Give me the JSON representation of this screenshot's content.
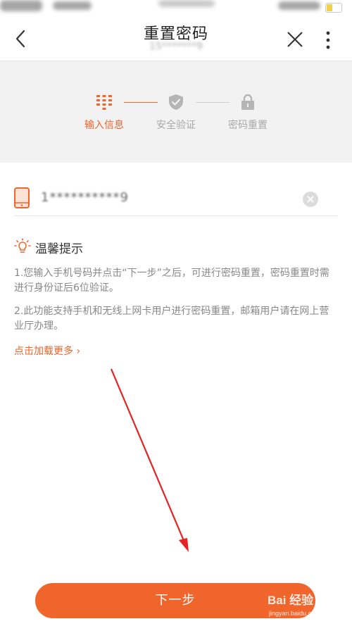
{
  "header": {
    "title": "重置密码",
    "subtitle": "15*******9"
  },
  "steps": [
    {
      "label": "输入信息",
      "state": "active",
      "icon": "keypad-icon"
    },
    {
      "label": "安全验证",
      "state": "inactive",
      "icon": "shield-check-icon"
    },
    {
      "label": "密码重置",
      "state": "inactive",
      "icon": "lock-icon"
    }
  ],
  "phone": {
    "value": "1**********9",
    "icon": "mobile-phone-icon"
  },
  "tips": {
    "title": "温馨提示",
    "items": [
      "1.您输入手机号码并点击“下一步”之后，可进行密码重置，密码重置时需进行身份证后6位验证。",
      "2.此功能支持手机和无线上网卡用户进行密码重置，邮箱用户请在网上营业厅办理。"
    ],
    "more_link": "点击加载更多 ›"
  },
  "next_button": "下一步",
  "watermark": {
    "brand": "Bai 经验",
    "url": "jingyan.baidu.com"
  },
  "colors": {
    "accent": "#f0652b",
    "inactive": "#a9a9a9",
    "panel": "#f2f2f2",
    "annotation_arrow": "#e62222"
  }
}
